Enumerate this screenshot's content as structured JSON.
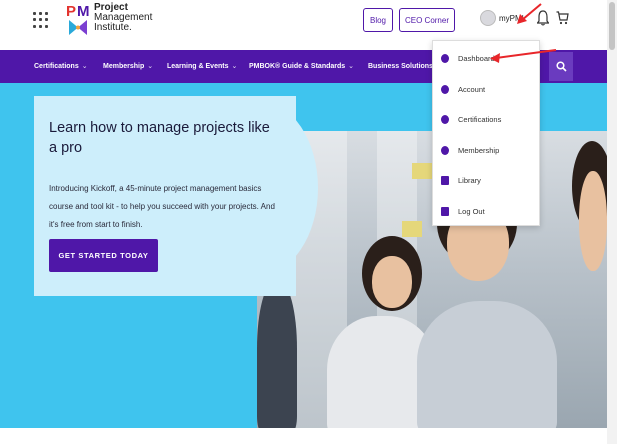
{
  "header": {
    "logo": {
      "line1": "Project",
      "line2": "Management",
      "line3": "Institute."
    },
    "blog_label": "Blog",
    "ceo_label": "CEO Corner",
    "account_label": "myPMI"
  },
  "nav": {
    "items": [
      {
        "label": "Certifications",
        "has_dropdown": true
      },
      {
        "label": "Membership",
        "has_dropdown": true
      },
      {
        "label": "Learning & Events",
        "has_dropdown": true
      },
      {
        "label": "PMBOK® Guide & Standards",
        "has_dropdown": true
      },
      {
        "label": "Business Solutions",
        "has_dropdown": true
      }
    ]
  },
  "dropdown": {
    "items": [
      {
        "label": "Dashboard",
        "icon": "dashboard-icon"
      },
      {
        "label": "Account",
        "icon": "account-icon"
      },
      {
        "label": "Certifications",
        "icon": "certifications-icon"
      },
      {
        "label": "Membership",
        "icon": "membership-icon"
      },
      {
        "label": "Library",
        "icon": "library-icon"
      },
      {
        "label": "Log Out",
        "icon": "logout-icon"
      }
    ]
  },
  "hero": {
    "title": "Learn how to manage projects like a pro",
    "description": "Introducing Kickoff, a 45-minute project management basics course and tool kit - to help you succeed with your projects. And it's free from start to finish.",
    "cta_label": "GET STARTED TODAY"
  },
  "colors": {
    "brand_purple": "#4f17a8",
    "hero_blue": "#3fc4ee",
    "card_light": "#cdeefb",
    "annotation_red": "#e8262a"
  }
}
